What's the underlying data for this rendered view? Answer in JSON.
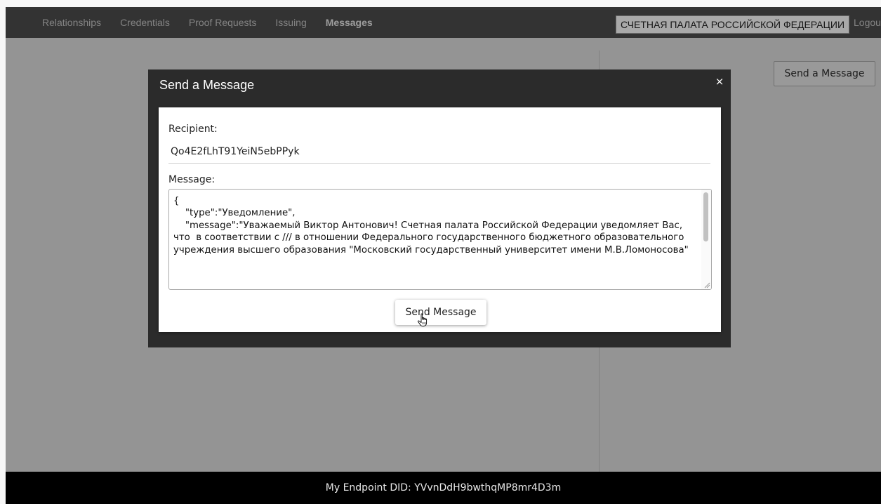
{
  "nav": {
    "items": [
      {
        "label": "Relationships"
      },
      {
        "label": "Credentials"
      },
      {
        "label": "Proof Requests"
      },
      {
        "label": "Issuing"
      },
      {
        "label": "Messages"
      }
    ],
    "active": "Messages",
    "org_name": "СЧЕТНАЯ ПАЛАТА РОССИЙСКОЙ ФЕДЕРАЦИИ",
    "logout_label": "Logout"
  },
  "page": {
    "send_message_button": "Send a Message"
  },
  "modal": {
    "title": "Send a Message",
    "close_glyph": "×",
    "recipient_label": "Recipient:",
    "recipient_value": "Qo4E2fLhT91YeiN5ebPPyk",
    "message_label": "Message:",
    "message_text": "{\n    \"type\":\"Уведомление\",\n    \"message\":\"Уважаемый Виктор Антонович! Счетная палата Российской Федерации уведомляет Вас, что  в соответствии с /// в отношении Федерального государственного бюджетного образовательного учреждения высшего образования \"Московский государственный университет имени М.В.Ломоносова\"",
    "send_button": "Send Message"
  },
  "footer": {
    "endpoint_text": "My Endpoint DID: YVvnDdH9bwthqMP8mr4D3m"
  }
}
